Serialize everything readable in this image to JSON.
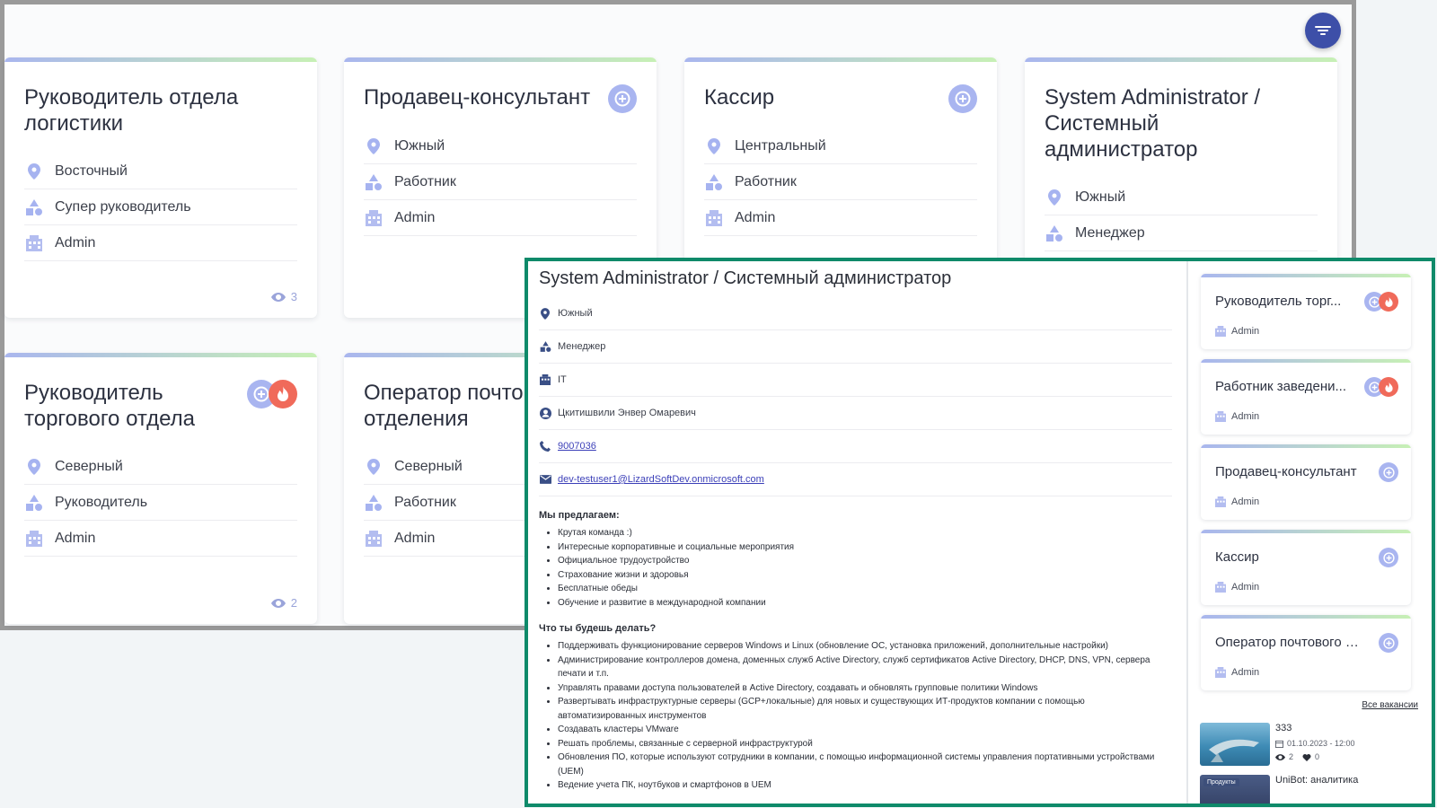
{
  "listing": {
    "cards": [
      {
        "title": "Руководитель отдела логистики",
        "region": "Восточный",
        "role": "Супер руководитель",
        "company": "Admin",
        "views": "3"
      },
      {
        "title": "Продавец-консультант",
        "region": "Южный",
        "role": "Работник",
        "company": "Admin"
      },
      {
        "title": "Кассир",
        "region": "Центральный",
        "role": "Работник",
        "company": "Admin"
      },
      {
        "title": "System Administrator / Системный администратор",
        "region": "Южный",
        "role": "Менеджер"
      },
      {
        "title": "Руководитель торгового отдела",
        "region": "Северный",
        "role": "Руководитель",
        "company": "Admin",
        "views": "2"
      },
      {
        "title": "Оператор почтового отделения",
        "region": "Северный",
        "role": "Работник",
        "company": "Admin"
      }
    ]
  },
  "detail": {
    "title": "System Administrator / Системный администратор",
    "region": "Южный",
    "role": "Менеджер",
    "department": "IT",
    "contact_person": "Цкитишвили Энвер Омаревич",
    "phone": "9007036",
    "email": "dev-testuser1@LizardSoftDev.onmicrosoft.com",
    "offer_title": "Мы предлагаем:",
    "offer": [
      "Крутая команда :)",
      "Интересные корпоративные и социальные мероприятия",
      "Официальное трудоустройство",
      "Страхование жизни и здоровья",
      "Бесплатные обеды",
      "Обучение и развитие в международной компании"
    ],
    "duties_title": "Что ты будешь делать?",
    "duties": [
      "Поддерживать функционирование серверов Windows и Linux (обновление ОС, установка приложений, дополнительные настройки)",
      "Администрирование контроллеров домена, доменных служб Active Directory, служб сертификатов Active Directory, DHCP, DNS, VPN, сервера печати и т.п.",
      "Управлять правами доступа пользователей в Active Directory, создавать и обновлять групповые политики Windows",
      "Развертывать инфраструктурные серверы (GCP+локальные) для новых и существующих ИТ-продуктов компании с помощью автоматизированных инструментов",
      "Создавать кластеры VMware",
      "Решать проблемы, связанные с серверной инфраструктурой",
      "Обновления ПО, которые используют сотрудники в компании, с помощью информационной системы управления портативными устройствами (UEM)",
      "Ведение учета ПК, ноутбуков и смартфонов в UEM"
    ]
  },
  "sidebar": {
    "cards": [
      {
        "title": "Руководитель торг...",
        "company": "Admin"
      },
      {
        "title": "Работник заведени...",
        "company": "Admin"
      },
      {
        "title": "Продавец-консультант",
        "company": "Admin"
      },
      {
        "title": "Кассир",
        "company": "Admin"
      },
      {
        "title": "Оператор почтового о...",
        "company": "Admin"
      }
    ],
    "all_vacancies": "Все вакансии",
    "news": [
      {
        "title": "333",
        "date": "01.10.2023 - 12:00",
        "views": "2",
        "likes": "0"
      },
      {
        "title": "UniBot: аналитика",
        "tag": "Продукты"
      }
    ]
  }
}
